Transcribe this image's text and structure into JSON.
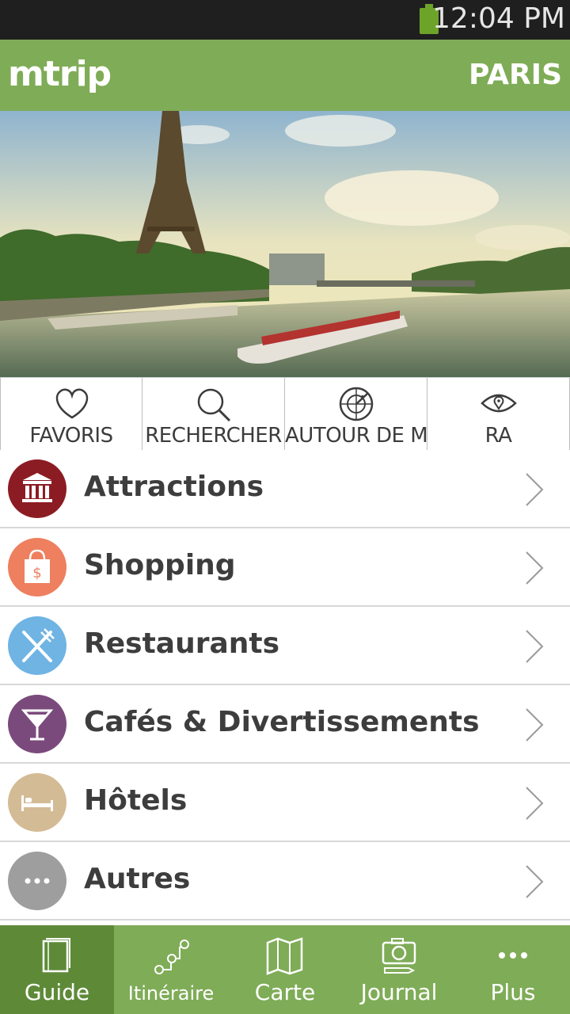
{
  "status_bar": {
    "time": "12:04 PM",
    "battery_icon": "battery-icon"
  },
  "app_bar": {
    "logo": "mtrip",
    "city": "PARIS"
  },
  "hero": {
    "icon": "eiffel-tower-photo"
  },
  "quick_actions": [
    {
      "label": "FAVORIS",
      "icon": "heart-icon"
    },
    {
      "label": "RECHERCHER",
      "icon": "search-icon"
    },
    {
      "label": "AUTOUR DE MOI",
      "icon": "radar-icon"
    },
    {
      "label": "RA",
      "icon": "eye-icon"
    }
  ],
  "categories": [
    {
      "label": "Attractions",
      "icon": "museum-icon",
      "color": "#8c1c24"
    },
    {
      "label": "Shopping",
      "icon": "shopping-bag-icon",
      "color": "#ee7f5f"
    },
    {
      "label": "Restaurants",
      "icon": "fork-knife-icon",
      "color": "#6fb4e3"
    },
    {
      "label": "Cafés & Divertissements",
      "icon": "cocktail-icon",
      "color": "#7b4a7c"
    },
    {
      "label": "Hôtels",
      "icon": "bed-icon",
      "color": "#d3bb95"
    },
    {
      "label": "Autres",
      "icon": "more-dots-icon",
      "color": "#9e9e9e"
    }
  ],
  "tabs": [
    {
      "label": "Guide",
      "icon": "book-icon",
      "active": true
    },
    {
      "label": "Itinéraire",
      "icon": "route-icon",
      "active": false
    },
    {
      "label": "Carte",
      "icon": "map-icon",
      "active": false
    },
    {
      "label": "Journal",
      "icon": "camera-icon",
      "active": false
    },
    {
      "label": "Plus",
      "icon": "more-icon",
      "active": false
    }
  ],
  "colors": {
    "brand_green": "#7fac57",
    "active_tab": "#5e8a38",
    "text_dark": "#3d3d3d"
  }
}
